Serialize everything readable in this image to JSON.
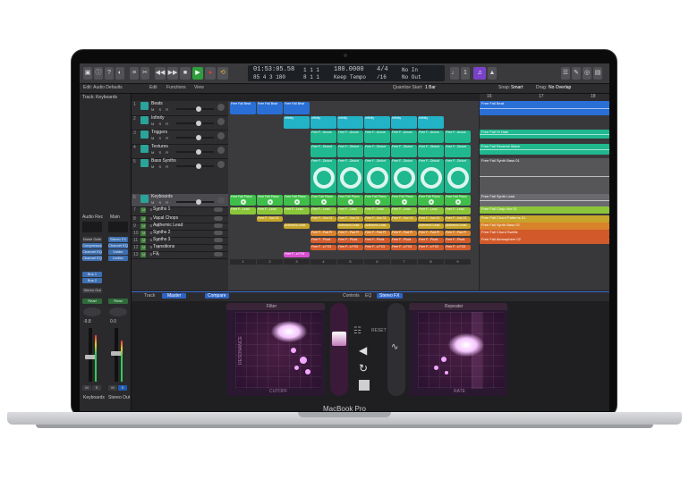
{
  "device": {
    "brand_label": "MacBook Pro"
  },
  "control_bar": {
    "lcd": {
      "time": "01:53:05.58",
      "bars_top": "1  1  1",
      "bars_bottom": "85  4  3  180",
      "bars_bottom2": "8  1  1",
      "tempo": "180.0000",
      "tempo_label": "Keep Tempo",
      "signature": "4/4",
      "division": "/16",
      "in_label": "No In",
      "out_label": "No Out"
    }
  },
  "toolbar2": {
    "inspector_title": "Edit: Audio Defaults",
    "track_label": "Track: Keyboards",
    "edit_menu": "Edit",
    "functions_menu": "Functions",
    "view_menu": "View",
    "snap_label": "Snap:",
    "snap_value": "Smart",
    "drag_label": "Drag:",
    "drag_value": "No Overlap",
    "quantize_label": "Quantize Start:",
    "quantize_value": "1 Bar"
  },
  "inspector": {
    "strip_left": "Audio Rec",
    "strip_right": "Main",
    "plugins_left": [
      "Noise Gate",
      "Compressor",
      "Channel EQ",
      "Channel EQ"
    ],
    "plugins_right": [
      "Stereo FX",
      "Channel EQ",
      "Vulder",
      "Limiter"
    ],
    "sends": [
      "Bus 1",
      "Bus 2"
    ],
    "output": "Stereo Out",
    "read_left": "Read",
    "read_right": "Read",
    "vol_left": "-9.8",
    "vol_right": "0.0",
    "name_left": "Keyboards",
    "name_right": "Stereo Out"
  },
  "tracks": [
    {
      "num": "1",
      "name": "Beats"
    },
    {
      "num": "2",
      "name": "Infinity"
    },
    {
      "num": "3",
      "name": "Triggers"
    },
    {
      "num": "4",
      "name": "Textures"
    },
    {
      "num": "5",
      "name": "Bass Synths"
    },
    {
      "num": "6",
      "name": "Keyboards"
    },
    {
      "num": "7",
      "name": "Synths 1"
    },
    {
      "num": "8",
      "name": "Vocal Chops"
    },
    {
      "num": "9",
      "name": "Anthemic Lead"
    },
    {
      "num": "10",
      "name": "Synths 2"
    },
    {
      "num": "11",
      "name": "Synths 3"
    },
    {
      "num": "12",
      "name": "Transitions"
    },
    {
      "num": "13",
      "name": "FX"
    }
  ],
  "grid_columns": [
    "1",
    "2",
    "3",
    "4",
    "5",
    "6",
    "7",
    "8",
    "9"
  ],
  "grid_clip_names": {
    "beats": "Free Fall Beat",
    "infinity": "Infinity",
    "triggers": "Free F...Acous",
    "textures": "Free F...Distort",
    "keyboards": "Free Fall Piano",
    "synths1": "Free F...Lead",
    "vocal": "Free F...Vox 01",
    "anthemic": "Anthemic Lead",
    "synth2": "Free F...Pad Pl",
    "synth3": "Free F...Pluck",
    "fx": "Free F...s FX3"
  },
  "timeline": {
    "ruler": [
      "16",
      "17",
      "18"
    ],
    "regions": [
      "Free Fall Beat",
      "Free Fall Hi Hats",
      "Free Fall Reverse Wave",
      "Free Fall Synth Bass 01",
      "Free Fall Synth Lead",
      "Free Fall Chop Vox 01",
      "Free Fall Chord Patterns 01",
      "Free Fall Synth Bass 02",
      "Free Fall Chord Swells",
      "Free Fall Atmosphere 02"
    ]
  },
  "bottom": {
    "tabs": [
      "Track",
      "Master",
      "Compare",
      "Controls",
      "EQ",
      "Stereo FX"
    ],
    "left_pad_title": "Filter",
    "left_pad_axis": "CUTOFF",
    "left_pad_y": "RESONANCE",
    "right_pad_title": "Repeater",
    "right_pad_axis": "RATE",
    "reset_label": "RESET"
  },
  "colors": {
    "blue": "#2a6fd6",
    "teal": "#23b3c7",
    "cyan_green": "#1fb88f",
    "green": "#3fbf4a",
    "lime": "#8bc63a",
    "yellow": "#c6a52a",
    "orange": "#d9822b",
    "red_orange": "#d25a2a",
    "pink": "#d94fd0"
  }
}
